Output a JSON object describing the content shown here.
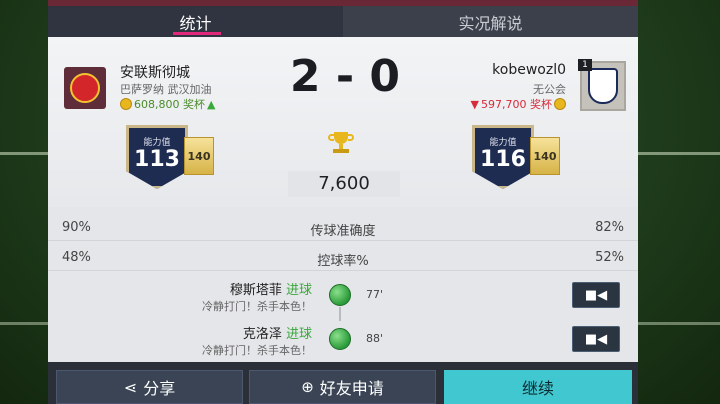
{
  "tabs": {
    "stats": "统计",
    "commentary": "实况解说"
  },
  "home": {
    "name": "安联斯彻城",
    "subtitle": "巴萨罗纳 武汉加油",
    "coins": "608,800 奖杯",
    "rating_label": "能力值",
    "rating": "113",
    "sub_rating": "140"
  },
  "away": {
    "name": "kobewozl0",
    "subtitle": "无公会",
    "coins": "597,700 奖杯",
    "rating_label": "能力值",
    "rating": "116",
    "sub_rating": "140",
    "badge_tag": "1"
  },
  "score": "2 - 0",
  "prize": "7,600",
  "stats": [
    {
      "label": "传球准确度",
      "home": "90%",
      "away": "82%"
    },
    {
      "label": "控球率%",
      "home": "48%",
      "away": "52%"
    }
  ],
  "events": [
    {
      "player": "穆斯塔菲",
      "tag": "进球",
      "note": "冷静打门！杀手本色！",
      "minute": "77'"
    },
    {
      "player": "克洛泽",
      "tag": "进球",
      "note": "冷静打门！杀手本色！",
      "minute": "88'"
    }
  ],
  "buttons": {
    "share": "分享",
    "friend": "好友申请",
    "continue": "继续"
  },
  "colors": {
    "accent": "#e0297a",
    "continue": "#40c7d0",
    "panel_top": "#6a2837"
  },
  "icons": [
    "share-icon",
    "add-friend-icon",
    "video-camera-icon",
    "trophy-icon",
    "coin-icon",
    "ball-icon"
  ]
}
